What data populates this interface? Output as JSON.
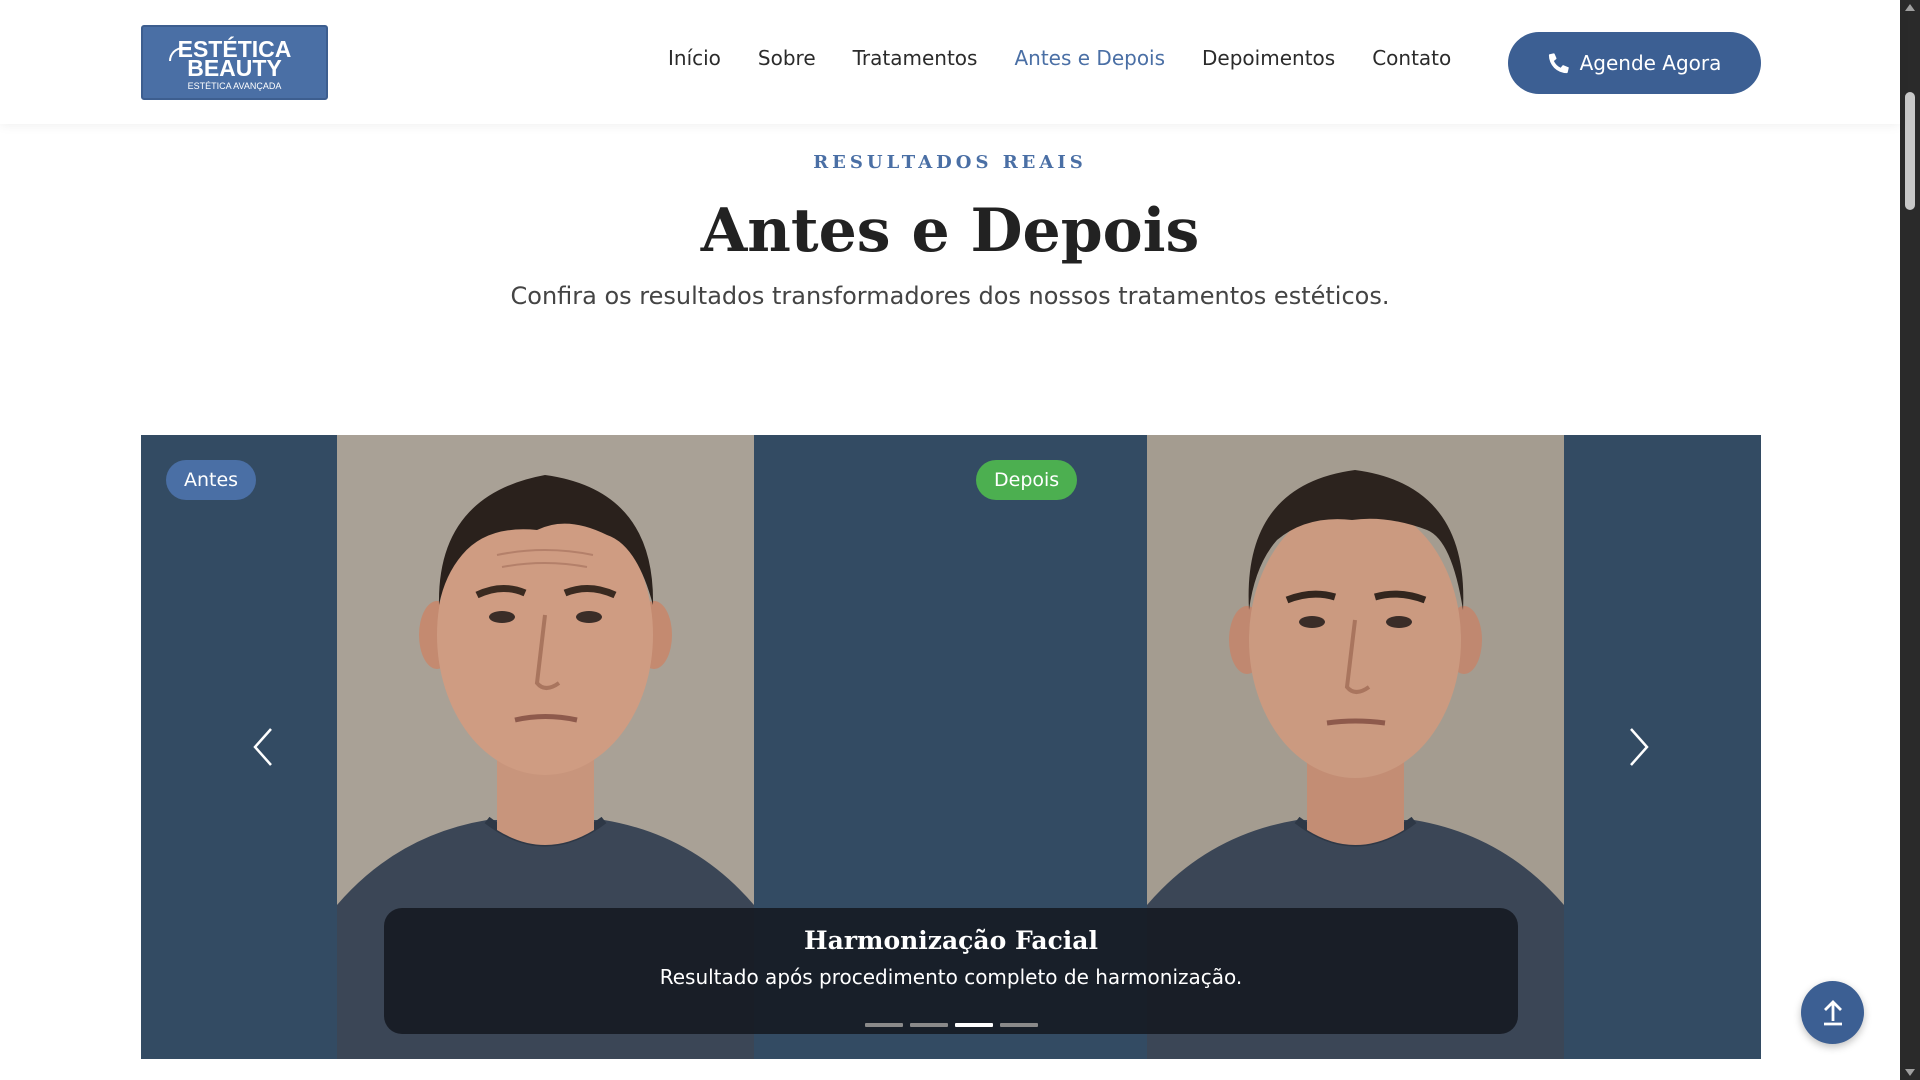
{
  "brand": {
    "line1": "ESTÉTICA",
    "line2": "BEAUTY",
    "tagline": "ESTÉTICA AVANÇADA"
  },
  "nav": {
    "items": [
      {
        "label": "Início",
        "active": false
      },
      {
        "label": "Sobre",
        "active": false
      },
      {
        "label": "Tratamentos",
        "active": false
      },
      {
        "label": "Antes e Depois",
        "active": true
      },
      {
        "label": "Depoimentos",
        "active": false
      },
      {
        "label": "Contato",
        "active": false
      }
    ],
    "cta_label": "Agende Agora",
    "cta_icon": "phone-icon"
  },
  "section": {
    "eyebrow": "RESULTADOS REAIS",
    "title": "Antes e Depois",
    "subtitle": "Confira os resultados transformadores dos nossos tratamentos estéticos."
  },
  "carousel": {
    "before_badge": "Antes",
    "after_badge": "Depois",
    "caption_title": "Harmonização Facial",
    "caption_text": "Resultado após procedimento completo de harmonização.",
    "slide_count": 4,
    "active_slide": 3,
    "prev_icon": "chevron-left-icon",
    "next_icon": "chevron-right-icon"
  },
  "colors": {
    "primary": "#4a6fa5",
    "primary_dark": "#3c5f93",
    "carousel_bg": "#334b63",
    "after_badge": "#4caf50"
  },
  "back_to_top_icon": "arrow-up-icon"
}
